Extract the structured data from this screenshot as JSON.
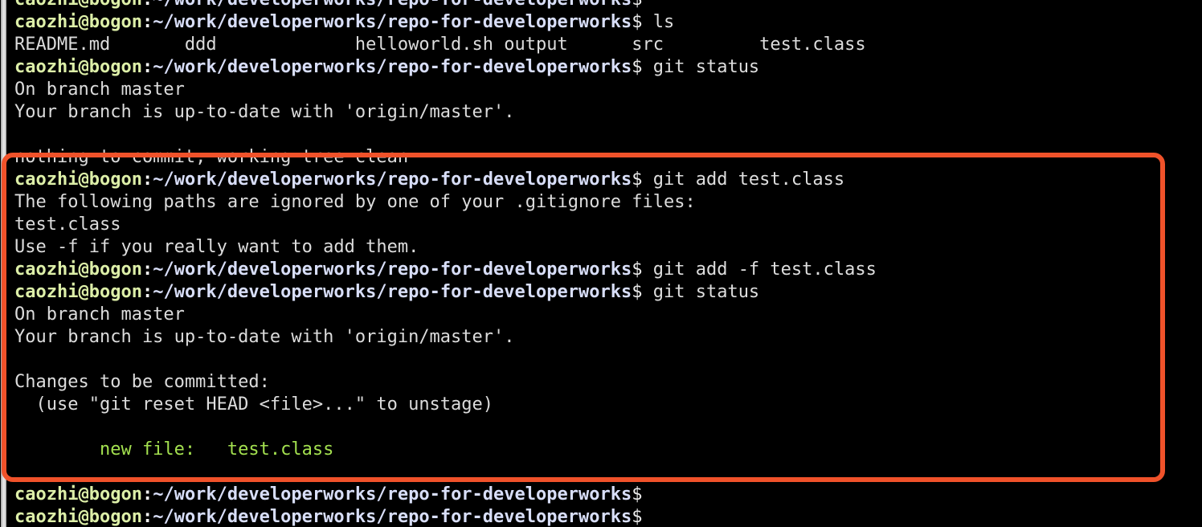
{
  "terminal": {
    "prompt": {
      "user_host": "caozhi@bogon",
      "separator": ":",
      "path": "~/work/developerworks/repo-for-developerworks",
      "symbol": "$"
    },
    "colors": {
      "background": "#000000",
      "user_host": "#ddefa8",
      "path": "#d8def8",
      "output": "#dcdcdc",
      "staged_file": "#a3e04f",
      "highlight_border": "#f0522a",
      "scrollbar": "#d6d6d6"
    },
    "lines": [
      {
        "type": "prompt",
        "command": ""
      },
      {
        "type": "prompt",
        "command": " ls"
      },
      {
        "type": "output",
        "text": "README.md       ddd             helloworld.sh output      src         test.class"
      },
      {
        "type": "prompt",
        "command": " git status"
      },
      {
        "type": "output",
        "text": "On branch master"
      },
      {
        "type": "output",
        "text": "Your branch is up-to-date with 'origin/master'."
      },
      {
        "type": "blank",
        "text": ""
      },
      {
        "type": "output",
        "text": "nothing to commit, working tree clean"
      },
      {
        "type": "prompt",
        "command": " git add test.class"
      },
      {
        "type": "output",
        "text": "The following paths are ignored by one of your .gitignore files:"
      },
      {
        "type": "output",
        "text": "test.class"
      },
      {
        "type": "output",
        "text": "Use -f if you really want to add them."
      },
      {
        "type": "prompt",
        "command": " git add -f test.class"
      },
      {
        "type": "prompt",
        "command": " git status"
      },
      {
        "type": "output",
        "text": "On branch master"
      },
      {
        "type": "output",
        "text": "Your branch is up-to-date with 'origin/master'."
      },
      {
        "type": "blank",
        "text": ""
      },
      {
        "type": "output",
        "text": "Changes to be committed:"
      },
      {
        "type": "output",
        "text": "  (use \"git reset HEAD <file>...\" to unstage)"
      },
      {
        "type": "blank",
        "text": ""
      },
      {
        "type": "staged",
        "text": "        new file:   test.class"
      },
      {
        "type": "blank",
        "text": ""
      },
      {
        "type": "prompt",
        "command": ""
      },
      {
        "type": "prompt",
        "command": ""
      }
    ],
    "ls_entries": [
      "README.md",
      "ddd",
      "helloworld.sh",
      "output",
      "src",
      "test.class"
    ],
    "highlight_note": "git add -f test.class staged output region"
  }
}
